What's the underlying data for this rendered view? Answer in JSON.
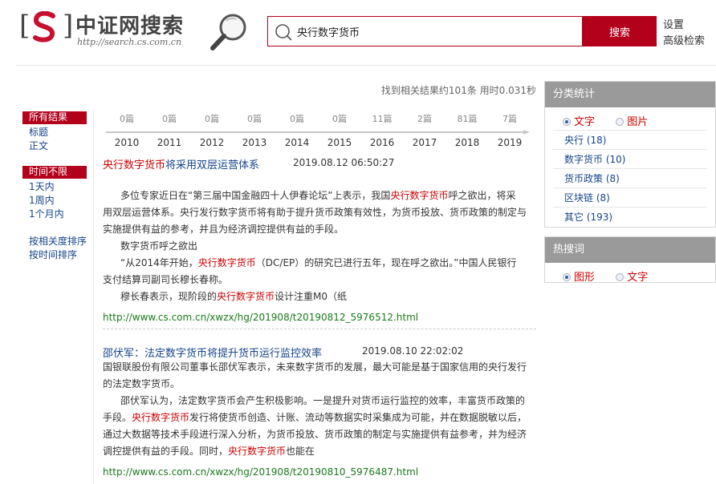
{
  "logo": {
    "bracket_left": "[",
    "bracket_right": "]",
    "title": "中证网搜索",
    "url": "http://search.cs.com.cn"
  },
  "search": {
    "query": "央行数字货币",
    "button_label": "搜索"
  },
  "header_links": {
    "settings": "设置",
    "advanced": "高级检索"
  },
  "summary": "找到相关结果约101条 用时0.031秒",
  "sidebar": {
    "scope_header": "所有结果",
    "scope_items": [
      "标题",
      "正文"
    ],
    "time_header": "时间不限",
    "time_items": [
      "1天内",
      "1周内",
      "1个月内"
    ],
    "sort_items": [
      "按相关度排序",
      "按时间排序"
    ]
  },
  "timeline": {
    "counts": [
      "0篇",
      "0篇",
      "0篇",
      "0篇",
      "0篇",
      "0篇",
      "11篇",
      "2篇",
      "81篇",
      "7篇"
    ],
    "years": [
      "2010",
      "2011",
      "2012",
      "2013",
      "2014",
      "2015",
      "2016",
      "2017",
      "2018",
      "2019"
    ]
  },
  "results": [
    {
      "title_hl": "央行数字货币",
      "title_rest": "将采用双层运营体系",
      "date": "2019.08.12 06:50:27",
      "p1_a": "多位专家近日在“第三届中国金融四十人伊春论坛”上表示，我国",
      "p1_hl": "央行数字货币",
      "p1_b": "呼之欲出，将采",
      "p1_c": "用双层运营体系。央行发行数字货币将有助于提升货币政策有效性，为货币投放、货币政策的制定与",
      "p1_d": "实施提供有益的参考，并且为经济调控提供有益的手段。",
      "p2": "数字货币呼之欲出",
      "p3_a": "“从2014年开始，",
      "p3_hl": "央行数字货币",
      "p3_b": "（DC/EP）的研究已进行五年，现在呼之欲出。”中国人民银行",
      "p3_c": "支付结算司副司长穆长春称。",
      "p4_a": "穆长春表示，现阶段的",
      "p4_hl": "央行数字货币",
      "p4_b": "设计注重M0（纸",
      "url": "http://www.cs.com.cn/xwzx/hg/201908/t20190812_5976512.html"
    },
    {
      "title": "邵伏军：法定数字货币将提升货币运行监控效率",
      "date": "2019.08.10 22:02:02",
      "l1": "国银联股份有限公司董事长邵伏军表示，未来数字货币的发展，最大可能是基于国家信用的央行发行",
      "l2": "的法定数字货币。",
      "l3": "邵伏军认为，法定数字货币会产生积极影响。一是提升对货币运行监控的效率，丰富货币政策的",
      "l4_a": "手段。",
      "l4_hl": "央行数字货币",
      "l4_b": "发行将使货币创造、计账、流动等数据实时采集成为可能，并在数据脱敏以后，",
      "l5": "通过大数据等技术手段进行深入分析，为货币投放、货币政策的制定与实施提供有益参考，并为经济",
      "l6_a": "调控提供有益的手段。同时，",
      "l6_hl": "央行数字货币",
      "l6_b": "也能在",
      "url": "http://www.cs.com.cn/xwzx/hg/201908/t20190810_5976487.html"
    }
  ],
  "category_panel": {
    "title": "分类统计",
    "radio_text": "文字",
    "radio_image": "图片",
    "items": [
      "央行 (18)",
      "数字货币 (10)",
      "货币政策 (8)",
      "区块链 (8)",
      "其它 (193)"
    ]
  },
  "hot_panel": {
    "title": "热搜词",
    "radio_graphic": "图形",
    "radio_text": "文字"
  },
  "colors": {
    "brand_red": "#b3001b",
    "link_blue": "#15448b",
    "highlight_red": "#cc0000",
    "url_green": "#1a7a1a",
    "panel_gray": "#9a9a9a"
  },
  "icons": {
    "logo": "cs-logo-icon",
    "magnifier": "magnifier-icon",
    "search_field": "search-icon"
  }
}
